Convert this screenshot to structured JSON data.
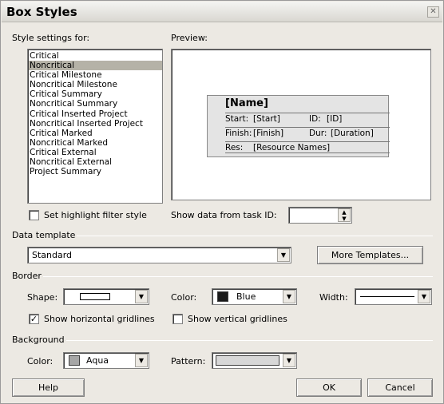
{
  "window": {
    "title": "Box Styles"
  },
  "style_settings": {
    "label": "Style settings for:",
    "items": [
      "Critical",
      "Noncritical",
      "Critical Milestone",
      "Noncritical Milestone",
      "Critical Summary",
      "Noncritical Summary",
      "Critical Inserted Project",
      "Noncritical Inserted Project",
      "Critical Marked",
      "Noncritical Marked",
      "Critical External",
      "Noncritical External",
      "Project Summary"
    ],
    "selected": "Noncritical"
  },
  "preview": {
    "label": "Preview:",
    "name": "[Name]",
    "start_label": "Start:",
    "start_value": "[Start]",
    "id_label": "ID:",
    "id_value": "[ID]",
    "finish_label": "Finish:",
    "finish_value": "[Finish]",
    "dur_label": "Dur:",
    "dur_value": "[Duration]",
    "res_label": "Res:",
    "res_value": "[Resource Names]"
  },
  "highlight_filter": {
    "label": "Set highlight filter style",
    "checked": false
  },
  "show_data": {
    "label": "Show data from task ID:",
    "value": ""
  },
  "data_template": {
    "label": "Data template",
    "value": "Standard",
    "more_button": "More Templates..."
  },
  "border": {
    "label": "Border",
    "shape_label": "Shape:",
    "color_label": "Color:",
    "color_value": "Blue",
    "color_swatch": "#1a1a1a",
    "width_label": "Width:",
    "horizontal_gridlines": {
      "label": "Show horizontal gridlines",
      "checked": true
    },
    "vertical_gridlines": {
      "label": "Show vertical gridlines",
      "checked": false
    }
  },
  "background": {
    "label": "Background",
    "color_label": "Color:",
    "color_value": "Aqua",
    "color_swatch": "#a6a6a6",
    "pattern_label": "Pattern:"
  },
  "buttons": {
    "help": "Help",
    "ok": "OK",
    "cancel": "Cancel"
  },
  "icons": {
    "close": "close-icon",
    "dropdown": "chevron-down-icon",
    "spinner": "spin-arrows-icon"
  }
}
